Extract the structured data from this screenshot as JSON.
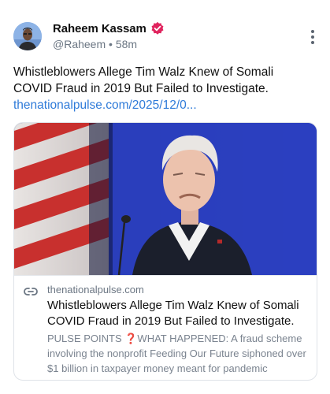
{
  "author": {
    "name": "Raheem Kassam",
    "handle": "@Raheem",
    "separator": "•",
    "time": "58m",
    "verified_color": "#e0245e"
  },
  "post": {
    "text": "Whistleblowers Allege Tim Walz Knew of Somali COVID Fraud in 2019 But Failed to Investigate.",
    "link": "thenationalpulse.com/2025/12/0..."
  },
  "card": {
    "domain": "thenationalpulse.com",
    "title": "Whistleblowers Allege Tim Walz Knew of Somali COVID Fraud in 2019 But Failed to Investigate.",
    "description": "PULSE POINTS ❓WHAT HAPPENED: A fraud scheme involving the nonprofit Feeding Our Future siphoned over $1 billion in taxpayer money meant for pandemic"
  },
  "icons": {
    "menu": "more-vertical-icon",
    "link": "link-icon",
    "verified": "verified-badge-icon"
  },
  "colors": {
    "link": "#2f7bd9",
    "muted": "#6b7683"
  }
}
